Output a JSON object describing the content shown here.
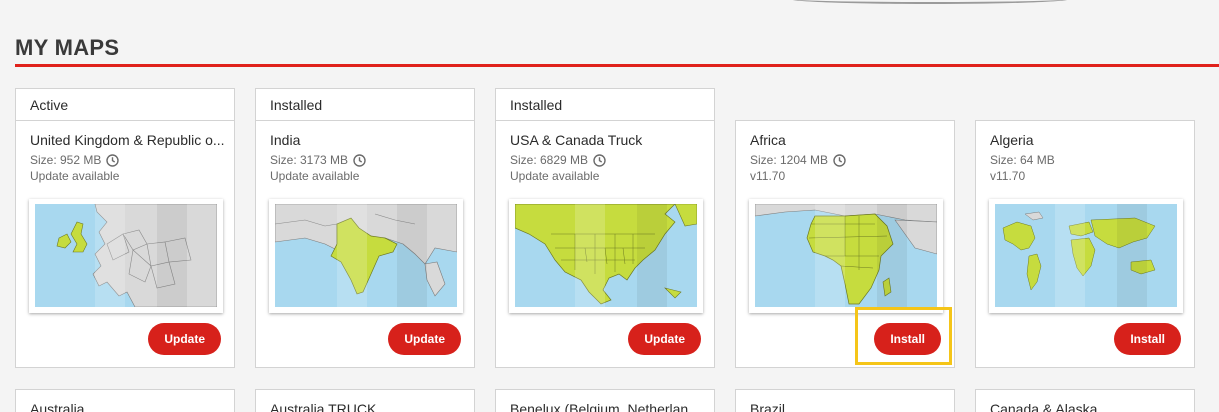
{
  "page": {
    "title": "MY MAPS"
  },
  "colors": {
    "accent": "#d7211b",
    "highlight": "#f5c518",
    "land": "#c6dc3e",
    "sea": "#a8d8ef"
  },
  "cards": [
    {
      "status": "Active",
      "name": "United Kingdom & Republic o...",
      "size": "Size:  952 MB",
      "sub": "Update available",
      "button": "Update",
      "icon": "clock-icon"
    },
    {
      "status": "Installed",
      "name": "India",
      "size": "Size:  3173 MB",
      "sub": "Update available",
      "button": "Update",
      "icon": "clock-icon"
    },
    {
      "status": "Installed",
      "name": "USA & Canada Truck",
      "size": "Size:  6829 MB",
      "sub": "Update available",
      "button": "Update",
      "icon": "clock-icon"
    },
    {
      "status": "",
      "name": "Africa",
      "size": "Size:  1204 MB",
      "sub": "v11.70",
      "button": "Install",
      "icon": "clock-icon"
    },
    {
      "status": "",
      "name": "Algeria",
      "size": "Size:  64 MB",
      "sub": "v11.70",
      "button": "Install",
      "icon": ""
    }
  ],
  "next_row": [
    "Australia",
    "Australia TRUCK",
    "Benelux (Belgium, Netherlan...",
    "Brazil",
    "Canada & Alaska"
  ]
}
